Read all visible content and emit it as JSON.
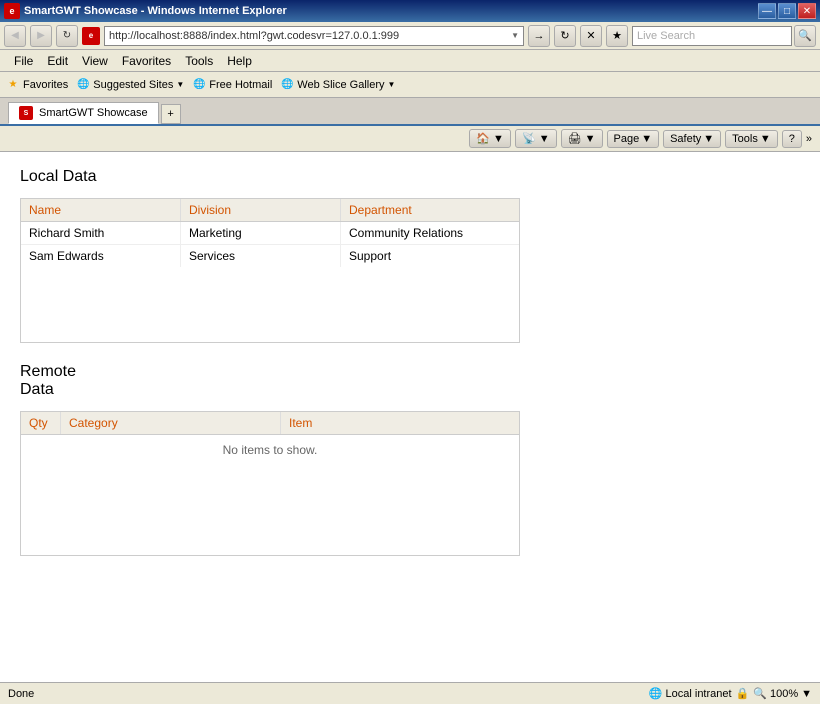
{
  "window": {
    "title": "SmartGWT Showcase - Windows Internet Explorer",
    "icon_label": "e"
  },
  "title_buttons": {
    "minimize": "—",
    "maximize": "□",
    "close": "✕"
  },
  "address_bar": {
    "url": "http://localhost:8888/index.html?gwt.codesvr=127.0.0.1:999",
    "dropdown_arrow": "▼"
  },
  "nav_buttons": {
    "back": "◀",
    "forward": "▶",
    "refresh": "↻",
    "stop": "✕",
    "search_placeholder": "Live Search",
    "search_label": "Search"
  },
  "menu": {
    "items": [
      "File",
      "Edit",
      "View",
      "Favorites",
      "Tools",
      "Help"
    ]
  },
  "favorites_bar": {
    "label": "Favorites",
    "items": [
      {
        "name": "Suggested Sites",
        "has_dropdown": true
      },
      {
        "name": "Free Hotmail",
        "has_dropdown": false
      },
      {
        "name": "Web Slice Gallery",
        "has_dropdown": true
      }
    ]
  },
  "tab": {
    "label": "SmartGWT Showcase",
    "new_tab": "+"
  },
  "browser_toolbar": {
    "home": "🏠",
    "rss": "📡",
    "print": "🖨",
    "page_label": "Page",
    "safety_label": "Safety",
    "tools_label": "Tools",
    "help": "?"
  },
  "local_data": {
    "title": "Local Data",
    "columns": [
      {
        "key": "name",
        "label": "Name"
      },
      {
        "key": "division",
        "label": "Division"
      },
      {
        "key": "department",
        "label": "Department"
      }
    ],
    "rows": [
      {
        "name": "Richard Smith",
        "division": "Marketing",
        "department": "Community Relations"
      },
      {
        "name": "Sam Edwards",
        "division": "Services",
        "department": "Support"
      }
    ]
  },
  "remote_data": {
    "title": "Remote\nData",
    "title_line1": "Remote",
    "title_line2": "Data",
    "columns": [
      {
        "key": "qty",
        "label": "Qty"
      },
      {
        "key": "category",
        "label": "Category"
      },
      {
        "key": "item",
        "label": "Item"
      }
    ],
    "empty_message": "No items to show."
  },
  "status_bar": {
    "status": "Done",
    "zone": "Local intranet",
    "zoom": "100%"
  }
}
